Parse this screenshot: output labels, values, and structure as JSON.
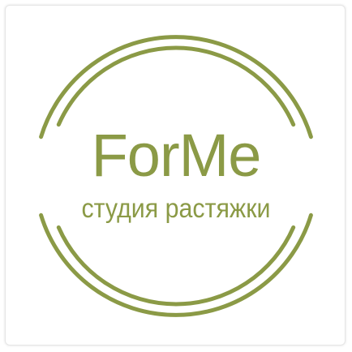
{
  "logo": {
    "brand_name": "ForMe",
    "tagline": "студия растяжки",
    "accent_color": "#8b9a46",
    "background_color": "#ffffff",
    "emblem": "double-ring-emblem"
  }
}
